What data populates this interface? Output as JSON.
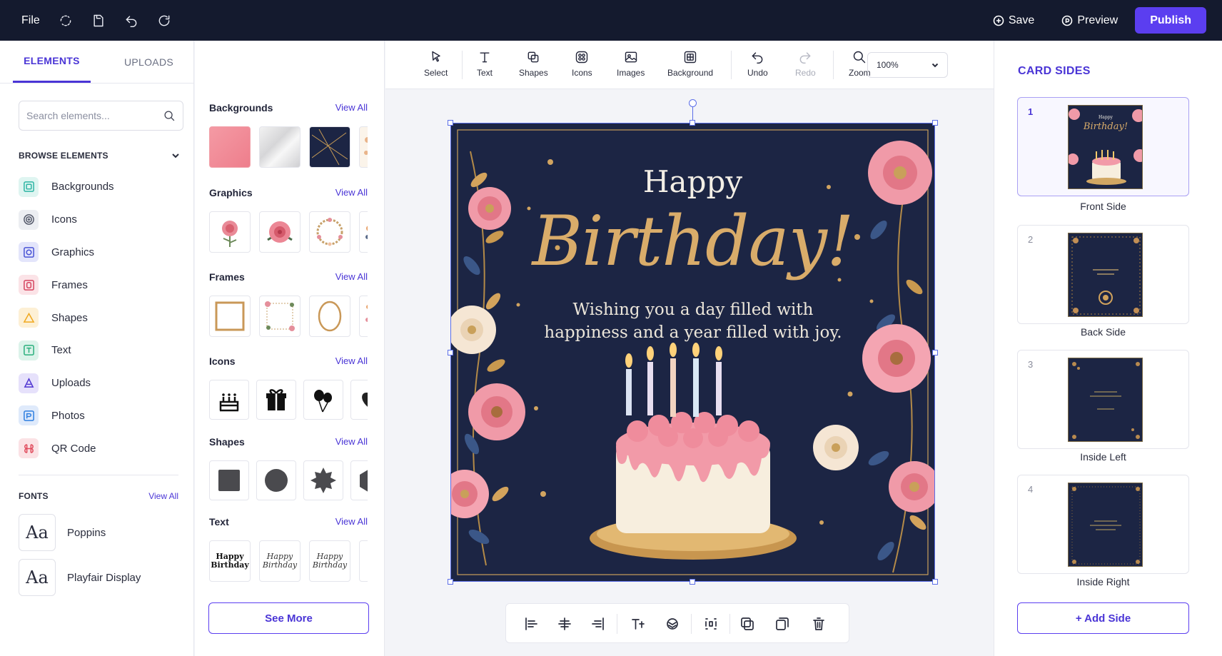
{
  "topbar": {
    "file_label": "File",
    "save_label": "Save",
    "preview_label": "Preview",
    "publish_label": "Publish"
  },
  "left": {
    "tabs": [
      {
        "label": "ELEMENTS",
        "active": true
      },
      {
        "label": "UPLOADS",
        "active": false
      }
    ],
    "search_placeholder": "Search elements...",
    "browse_label": "BROWSE ELEMENTS",
    "elements": [
      {
        "label": "Backgrounds",
        "icon": "backgrounds-icon",
        "color": "#2fb5a4"
      },
      {
        "label": "Icons",
        "icon": "icons-icon",
        "color": "#6b7080"
      },
      {
        "label": "Graphics",
        "icon": "graphics-icon",
        "color": "#4a54d6"
      },
      {
        "label": "Frames",
        "icon": "frames-icon",
        "color": "#d6455f"
      },
      {
        "label": "Shapes",
        "icon": "shapes-icon",
        "color": "#f0a81f"
      },
      {
        "label": "Text",
        "icon": "text-icon",
        "color": "#2bb07e"
      },
      {
        "label": "Uploads",
        "icon": "uploads-icon",
        "color": "#4f35d1"
      },
      {
        "label": "Photos",
        "icon": "photos-icon",
        "color": "#2f7fe0"
      },
      {
        "label": "QR Code",
        "icon": "qr-code-icon",
        "color": "#e04a5c"
      }
    ],
    "fonts_label": "FONTS",
    "fonts_view_all": "View All",
    "fonts": [
      {
        "sample": "Aa",
        "name": "Poppins"
      },
      {
        "sample": "Aa",
        "name": "Playfair Display"
      }
    ]
  },
  "assets": {
    "sections": [
      {
        "title": "Backgrounds",
        "view_all": "View All"
      },
      {
        "title": "Graphics",
        "view_all": "View All"
      },
      {
        "title": "Frames",
        "view_all": "View All"
      },
      {
        "title": "Icons",
        "view_all": "View All"
      },
      {
        "title": "Shapes",
        "view_all": "View All"
      },
      {
        "title": "Text",
        "view_all": "View All"
      }
    ],
    "text_samples": [
      "Happy Birthday",
      "Happy Birthday",
      "Happy Birthday"
    ],
    "see_more_label": "See More"
  },
  "toolbar": {
    "tools": [
      "Select",
      "Text",
      "Shapes",
      "Icons",
      "Images",
      "Background",
      "Undo",
      "Redo",
      "Zoom"
    ],
    "zoom_level": "100%"
  },
  "card": {
    "line1": "Happy",
    "line2": "Birthday!",
    "message": "Wishing you a day filled with happiness and a year filled with joy.",
    "bg_color": "#1c2544",
    "accent_color": "#d9ac6a"
  },
  "right": {
    "title": "CARD SIDES",
    "sides": [
      {
        "number": "1",
        "label": "Front Side",
        "active": true
      },
      {
        "number": "2",
        "label": "Back Side",
        "active": false
      },
      {
        "number": "3",
        "label": "Inside Left",
        "active": false
      },
      {
        "number": "4",
        "label": "Inside Right",
        "active": false
      }
    ],
    "add_side_label": "+ Add Side"
  },
  "colors": {
    "brand": "#5b3ef0",
    "topbar": "#141a2e"
  }
}
